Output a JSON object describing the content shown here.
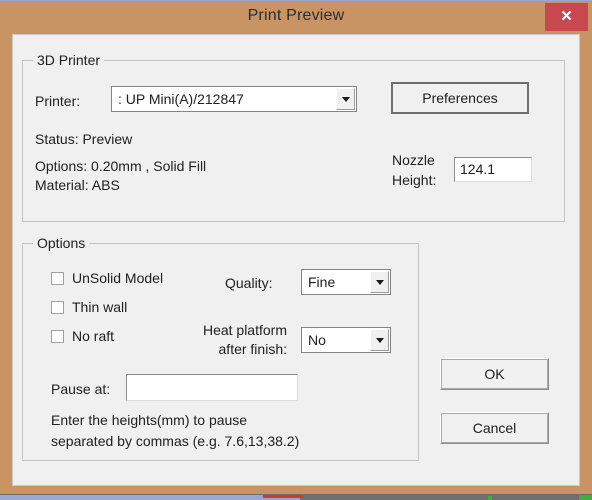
{
  "window": {
    "title": "Print Preview",
    "close_label": "✕",
    "titlebar_color": "#c89463",
    "close_button_color": "#c9474f",
    "client_color": "#f0f0f0"
  },
  "printer_group": {
    "title": "3D Printer",
    "printer_label": "Printer:",
    "printer_value": ": UP Mini(A)/212847",
    "preferences_label": "Preferences",
    "status_label": "Status: Preview",
    "options_label": "Options: 0.20mm , Solid Fill",
    "material_label": "Material: ABS",
    "nozzle_label": "Nozzle\nHeight:",
    "nozzle_label_line1": "Nozzle",
    "nozzle_label_line2": "Height:",
    "nozzle_value": "124.1"
  },
  "options_group": {
    "title": "Options",
    "checkboxes": [
      {
        "label": "UnSolid Model",
        "checked": false
      },
      {
        "label": "Thin wall",
        "checked": false
      },
      {
        "label": "No raft",
        "checked": false
      }
    ],
    "quality_label": "Quality:",
    "quality_value": "Fine",
    "heat_label_line1": "Heat platform",
    "heat_label_line2": "after finish:",
    "heat_value": "No",
    "pause_label": "Pause at:",
    "pause_value": "",
    "hint_line1": "Enter the heights(mm) to pause",
    "hint_line2": "separated by commas (e.g. 7.6,13,38.2)"
  },
  "actions": {
    "ok_label": "OK",
    "cancel_label": "Cancel"
  }
}
